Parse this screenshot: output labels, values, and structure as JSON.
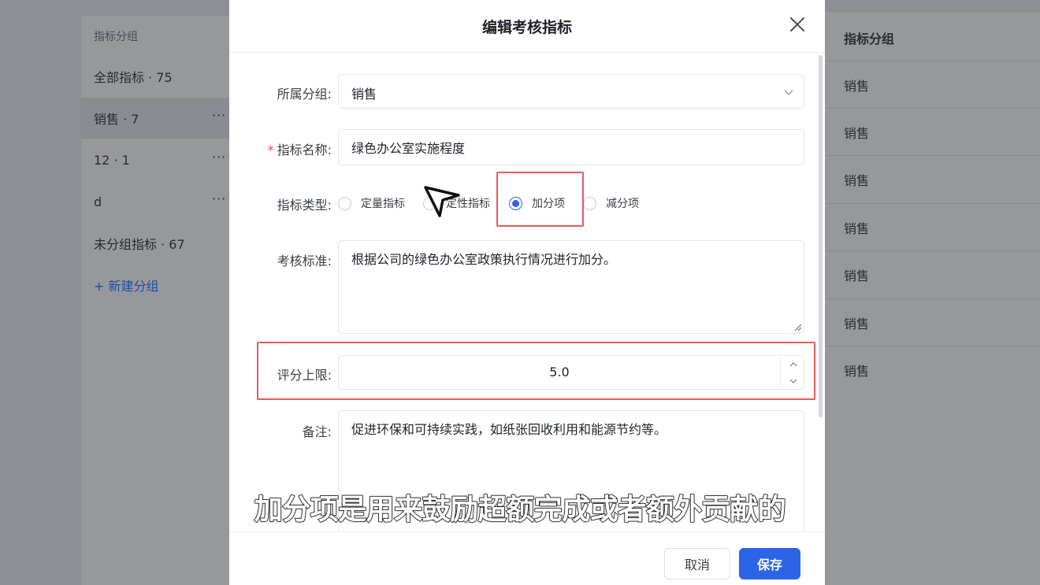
{
  "background": {
    "sidebar": {
      "header": "指标分组",
      "groups": [
        {
          "label": "全部指标 · 75",
          "more": ""
        },
        {
          "label": "销售 · 7",
          "more": "···"
        },
        {
          "label": "12 · 1",
          "more": "···"
        },
        {
          "label": "d",
          "more": "···"
        },
        {
          "label": "未分组指标 · 67",
          "more": ""
        }
      ],
      "new_group": "+ 新建分组"
    },
    "table": {
      "column_header": "指标分组",
      "rows": [
        "销售",
        "销售",
        "销售",
        "销售",
        "销售",
        "销售",
        "销售"
      ]
    }
  },
  "modal": {
    "title": "编辑考核指标",
    "fields": {
      "group": {
        "label": "所属分组:",
        "value": "销售"
      },
      "name": {
        "label": "指标名称:",
        "required_mark": "*",
        "value": "绿色办公室实施程度"
      },
      "type": {
        "label": "指标类型:",
        "options": [
          "定量指标",
          "定性指标",
          "加分项",
          "减分项"
        ],
        "selected": "加分项"
      },
      "criteria": {
        "label": "考核标准:",
        "value": "根据公司的绿色办公室政策执行情况进行加分。"
      },
      "max_score": {
        "label": "评分上限:",
        "value": "5.0"
      },
      "remark": {
        "label": "备注:",
        "value": "促进环保和可持续实践，如纸张回收利用和能源节约等。"
      }
    },
    "buttons": {
      "cancel": "取消",
      "save": "保存"
    }
  },
  "subtitle": "加分项是用来鼓励超额完成或者额外贡献的",
  "colors": {
    "primary": "#2b65e6",
    "highlight": "#ea5a5a",
    "required": "#e34d59"
  }
}
